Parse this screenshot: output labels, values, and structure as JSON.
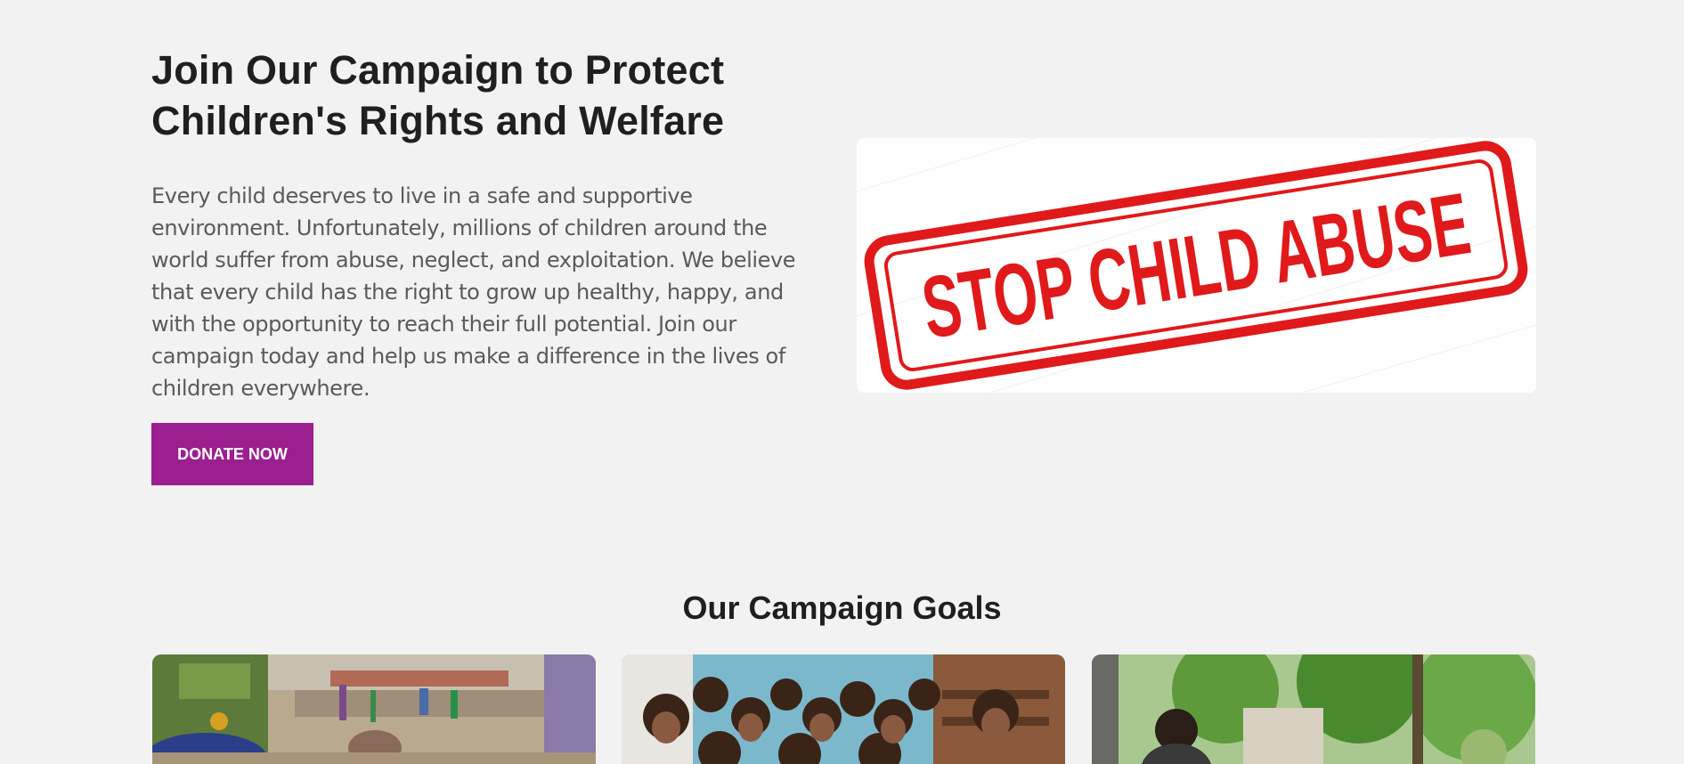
{
  "hero": {
    "title_line1": "Join Our Campaign to Protect",
    "title_line2": "Children's Rights and Welfare",
    "body": "Every child deserves to live in a safe and supportive environment. Unfortunately, millions of children around the world suffer from abuse, neglect, and exploitation. We believe that every child has the right to grow up healthy, happy, and with the opportunity to reach their full potential. Join our campaign today and help us make a difference in the lives of children everywhere.",
    "donate_label": "DONATE NOW",
    "image_stamp_text": "STOP CHILD ABUSE"
  },
  "goals": {
    "title": "Our Campaign Goals",
    "cards": [
      {
        "image": "children-yard-photo"
      },
      {
        "image": "girls-group-photo"
      },
      {
        "image": "trees-outdoor-photo"
      }
    ]
  },
  "colors": {
    "background": "#f2f2f2",
    "accent": "#9b1f8e",
    "stamp_red": "#e0191b",
    "heading": "#1f1f1f",
    "body_text": "#5a5a5a"
  }
}
